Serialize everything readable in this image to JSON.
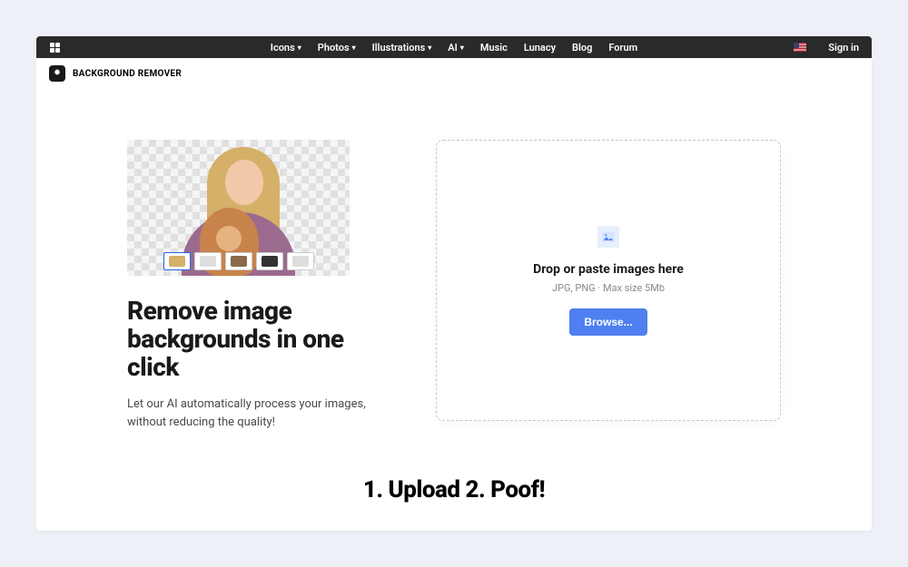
{
  "topnav": {
    "items": [
      {
        "label": "Icons",
        "dropdown": true
      },
      {
        "label": "Photos",
        "dropdown": true
      },
      {
        "label": "Illustrations",
        "dropdown": true
      },
      {
        "label": "AI",
        "dropdown": true
      },
      {
        "label": "Music",
        "dropdown": false
      },
      {
        "label": "Lunacy",
        "dropdown": false
      },
      {
        "label": "Blog",
        "dropdown": false
      },
      {
        "label": "Forum",
        "dropdown": false
      }
    ],
    "signin": "Sign in"
  },
  "subheader": {
    "title": "BACKGROUND REMOVER"
  },
  "hero": {
    "headline": "Remove image backgrounds in one click",
    "subtext": "Let our AI automatically process your images, without reducing the quality!",
    "thumbnails": 5
  },
  "dropzone": {
    "title": "Drop or paste images here",
    "subtitle": "JPG, PNG · Max size 5Mb",
    "browse": "Browse..."
  },
  "steps": {
    "text": "1. Upload 2. Poof!"
  }
}
